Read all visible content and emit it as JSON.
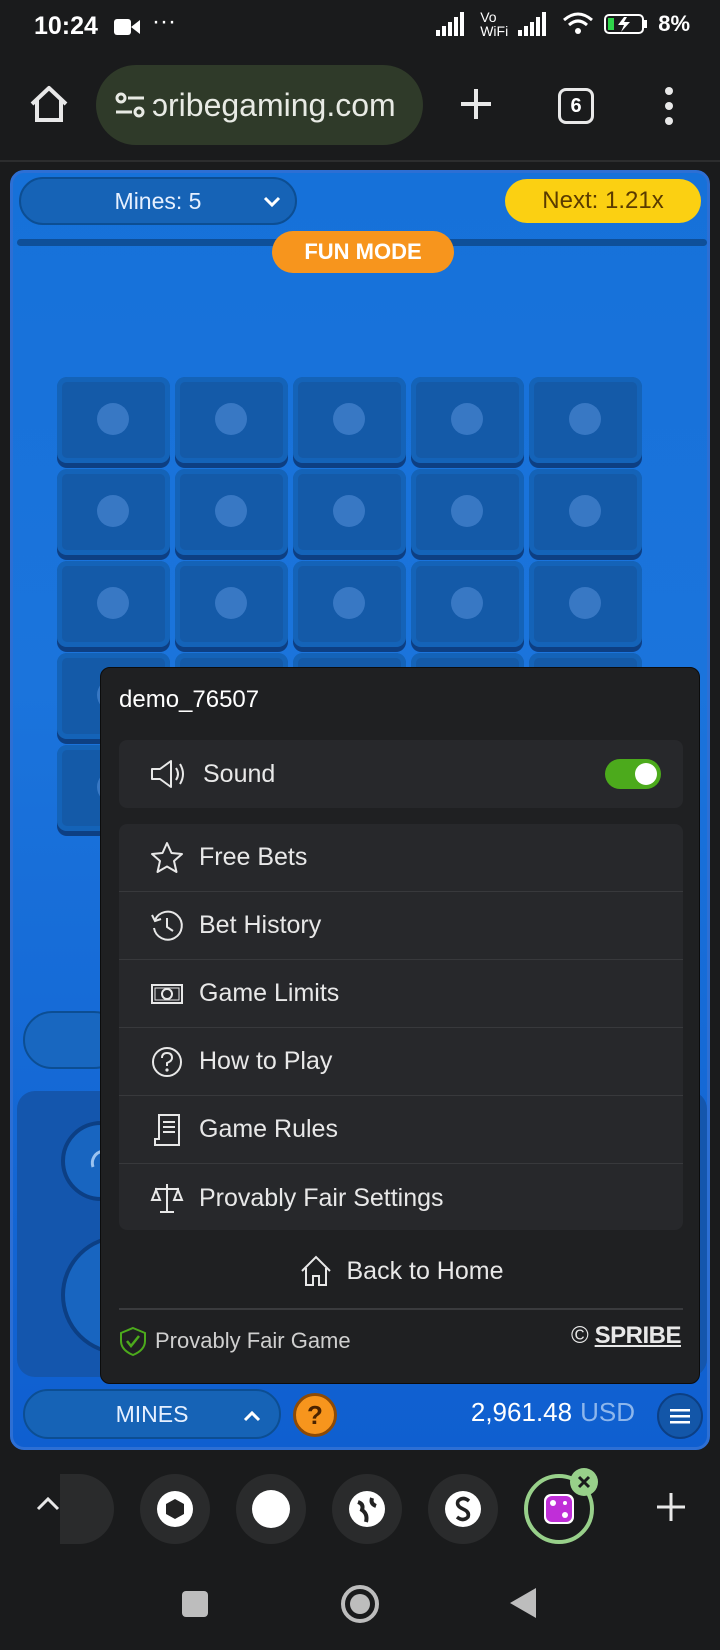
{
  "status": {
    "time": "10:24",
    "network_label": "Vo WiFi",
    "battery": "8%"
  },
  "browser": {
    "url": "ɔribegaming.com",
    "tab_count": "6"
  },
  "game": {
    "mines_label": "Mines: 5",
    "next_label": "Next: 1.21x",
    "mode_label": "FUN MODE",
    "game_name": "MINES",
    "help_label": "?",
    "balance": "2,961.48",
    "currency": "USD"
  },
  "menu": {
    "username": "demo_76507",
    "sound_label": "Sound",
    "sound_on": true,
    "items": [
      {
        "label": "Free Bets",
        "icon": "star-icon"
      },
      {
        "label": "Bet History",
        "icon": "history-icon"
      },
      {
        "label": "Game Limits",
        "icon": "banknote-icon"
      },
      {
        "label": "How to Play",
        "icon": "question-circle-icon"
      },
      {
        "label": "Game Rules",
        "icon": "document-icon"
      },
      {
        "label": "Provably Fair Settings",
        "icon": "scales-icon"
      }
    ],
    "home_label": "Back to Home",
    "provably_fair_label": "Provably Fair Game",
    "copyright_symbol": "©",
    "brand": "SPRIBE"
  },
  "colors": {
    "accent_yellow": "#fbd012",
    "accent_orange": "#f7951d",
    "toggle_green": "#4caa1c",
    "game_blue": "#1671d9"
  }
}
